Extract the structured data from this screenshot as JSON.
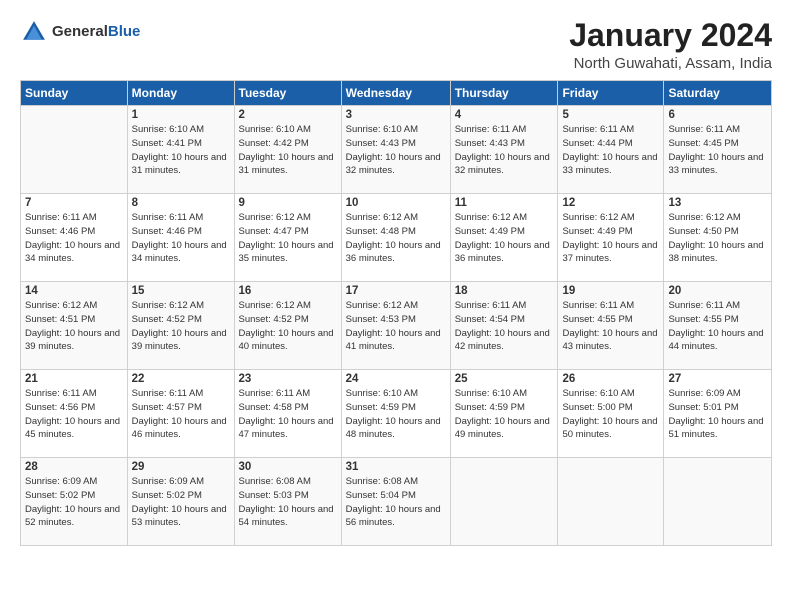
{
  "logo": {
    "general": "General",
    "blue": "Blue"
  },
  "header": {
    "month": "January 2024",
    "location": "North Guwahati, Assam, India"
  },
  "columns": [
    "Sunday",
    "Monday",
    "Tuesday",
    "Wednesday",
    "Thursday",
    "Friday",
    "Saturday"
  ],
  "weeks": [
    [
      {
        "day": "",
        "sunrise": "",
        "sunset": "",
        "daylight": ""
      },
      {
        "day": "1",
        "sunrise": "Sunrise: 6:10 AM",
        "sunset": "Sunset: 4:41 PM",
        "daylight": "Daylight: 10 hours and 31 minutes."
      },
      {
        "day": "2",
        "sunrise": "Sunrise: 6:10 AM",
        "sunset": "Sunset: 4:42 PM",
        "daylight": "Daylight: 10 hours and 31 minutes."
      },
      {
        "day": "3",
        "sunrise": "Sunrise: 6:10 AM",
        "sunset": "Sunset: 4:43 PM",
        "daylight": "Daylight: 10 hours and 32 minutes."
      },
      {
        "day": "4",
        "sunrise": "Sunrise: 6:11 AM",
        "sunset": "Sunset: 4:43 PM",
        "daylight": "Daylight: 10 hours and 32 minutes."
      },
      {
        "day": "5",
        "sunrise": "Sunrise: 6:11 AM",
        "sunset": "Sunset: 4:44 PM",
        "daylight": "Daylight: 10 hours and 33 minutes."
      },
      {
        "day": "6",
        "sunrise": "Sunrise: 6:11 AM",
        "sunset": "Sunset: 4:45 PM",
        "daylight": "Daylight: 10 hours and 33 minutes."
      }
    ],
    [
      {
        "day": "7",
        "sunrise": "Sunrise: 6:11 AM",
        "sunset": "Sunset: 4:46 PM",
        "daylight": "Daylight: 10 hours and 34 minutes."
      },
      {
        "day": "8",
        "sunrise": "Sunrise: 6:11 AM",
        "sunset": "Sunset: 4:46 PM",
        "daylight": "Daylight: 10 hours and 34 minutes."
      },
      {
        "day": "9",
        "sunrise": "Sunrise: 6:12 AM",
        "sunset": "Sunset: 4:47 PM",
        "daylight": "Daylight: 10 hours and 35 minutes."
      },
      {
        "day": "10",
        "sunrise": "Sunrise: 6:12 AM",
        "sunset": "Sunset: 4:48 PM",
        "daylight": "Daylight: 10 hours and 36 minutes."
      },
      {
        "day": "11",
        "sunrise": "Sunrise: 6:12 AM",
        "sunset": "Sunset: 4:49 PM",
        "daylight": "Daylight: 10 hours and 36 minutes."
      },
      {
        "day": "12",
        "sunrise": "Sunrise: 6:12 AM",
        "sunset": "Sunset: 4:49 PM",
        "daylight": "Daylight: 10 hours and 37 minutes."
      },
      {
        "day": "13",
        "sunrise": "Sunrise: 6:12 AM",
        "sunset": "Sunset: 4:50 PM",
        "daylight": "Daylight: 10 hours and 38 minutes."
      }
    ],
    [
      {
        "day": "14",
        "sunrise": "Sunrise: 6:12 AM",
        "sunset": "Sunset: 4:51 PM",
        "daylight": "Daylight: 10 hours and 39 minutes."
      },
      {
        "day": "15",
        "sunrise": "Sunrise: 6:12 AM",
        "sunset": "Sunset: 4:52 PM",
        "daylight": "Daylight: 10 hours and 39 minutes."
      },
      {
        "day": "16",
        "sunrise": "Sunrise: 6:12 AM",
        "sunset": "Sunset: 4:52 PM",
        "daylight": "Daylight: 10 hours and 40 minutes."
      },
      {
        "day": "17",
        "sunrise": "Sunrise: 6:12 AM",
        "sunset": "Sunset: 4:53 PM",
        "daylight": "Daylight: 10 hours and 41 minutes."
      },
      {
        "day": "18",
        "sunrise": "Sunrise: 6:11 AM",
        "sunset": "Sunset: 4:54 PM",
        "daylight": "Daylight: 10 hours and 42 minutes."
      },
      {
        "day": "19",
        "sunrise": "Sunrise: 6:11 AM",
        "sunset": "Sunset: 4:55 PM",
        "daylight": "Daylight: 10 hours and 43 minutes."
      },
      {
        "day": "20",
        "sunrise": "Sunrise: 6:11 AM",
        "sunset": "Sunset: 4:55 PM",
        "daylight": "Daylight: 10 hours and 44 minutes."
      }
    ],
    [
      {
        "day": "21",
        "sunrise": "Sunrise: 6:11 AM",
        "sunset": "Sunset: 4:56 PM",
        "daylight": "Daylight: 10 hours and 45 minutes."
      },
      {
        "day": "22",
        "sunrise": "Sunrise: 6:11 AM",
        "sunset": "Sunset: 4:57 PM",
        "daylight": "Daylight: 10 hours and 46 minutes."
      },
      {
        "day": "23",
        "sunrise": "Sunrise: 6:11 AM",
        "sunset": "Sunset: 4:58 PM",
        "daylight": "Daylight: 10 hours and 47 minutes."
      },
      {
        "day": "24",
        "sunrise": "Sunrise: 6:10 AM",
        "sunset": "Sunset: 4:59 PM",
        "daylight": "Daylight: 10 hours and 48 minutes."
      },
      {
        "day": "25",
        "sunrise": "Sunrise: 6:10 AM",
        "sunset": "Sunset: 4:59 PM",
        "daylight": "Daylight: 10 hours and 49 minutes."
      },
      {
        "day": "26",
        "sunrise": "Sunrise: 6:10 AM",
        "sunset": "Sunset: 5:00 PM",
        "daylight": "Daylight: 10 hours and 50 minutes."
      },
      {
        "day": "27",
        "sunrise": "Sunrise: 6:09 AM",
        "sunset": "Sunset: 5:01 PM",
        "daylight": "Daylight: 10 hours and 51 minutes."
      }
    ],
    [
      {
        "day": "28",
        "sunrise": "Sunrise: 6:09 AM",
        "sunset": "Sunset: 5:02 PM",
        "daylight": "Daylight: 10 hours and 52 minutes."
      },
      {
        "day": "29",
        "sunrise": "Sunrise: 6:09 AM",
        "sunset": "Sunset: 5:02 PM",
        "daylight": "Daylight: 10 hours and 53 minutes."
      },
      {
        "day": "30",
        "sunrise": "Sunrise: 6:08 AM",
        "sunset": "Sunset: 5:03 PM",
        "daylight": "Daylight: 10 hours and 54 minutes."
      },
      {
        "day": "31",
        "sunrise": "Sunrise: 6:08 AM",
        "sunset": "Sunset: 5:04 PM",
        "daylight": "Daylight: 10 hours and 56 minutes."
      },
      {
        "day": "",
        "sunrise": "",
        "sunset": "",
        "daylight": ""
      },
      {
        "day": "",
        "sunrise": "",
        "sunset": "",
        "daylight": ""
      },
      {
        "day": "",
        "sunrise": "",
        "sunset": "",
        "daylight": ""
      }
    ]
  ]
}
